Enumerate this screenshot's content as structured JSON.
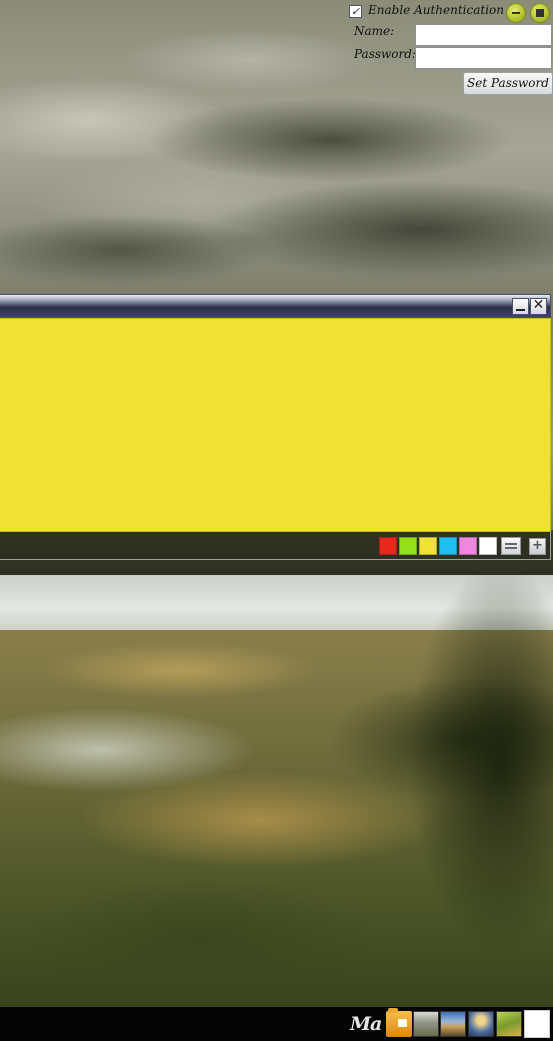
{
  "auth": {
    "checkbox_mark": "✓",
    "enable_label": "Enable Authentication",
    "name_label": "Name:",
    "name_value": "",
    "password_label": "Password:",
    "password_value": "",
    "set_password_label": "Set Password",
    "minimize_icon": "minus-circle-icon",
    "maximize_icon": "square-circle-icon"
  },
  "note": {
    "text": "",
    "close_glyph": "✕",
    "colors": [
      "#e8281c",
      "#94e01a",
      "#f0e232",
      "#1ebfef",
      "#ef86e0",
      "#ffffff"
    ],
    "color_names": [
      "red",
      "green",
      "yellow",
      "cyan",
      "pink",
      "white"
    ],
    "add_glyph": "+"
  },
  "taskbar": {
    "logo_text": "Ma",
    "apps": [
      "folder-icon",
      "wallpaper-thumb-lake",
      "wallpaper-thumb-coast",
      "wallpaper-thumb-sunset",
      "wallpaper-thumb-field",
      "blank-window"
    ]
  }
}
